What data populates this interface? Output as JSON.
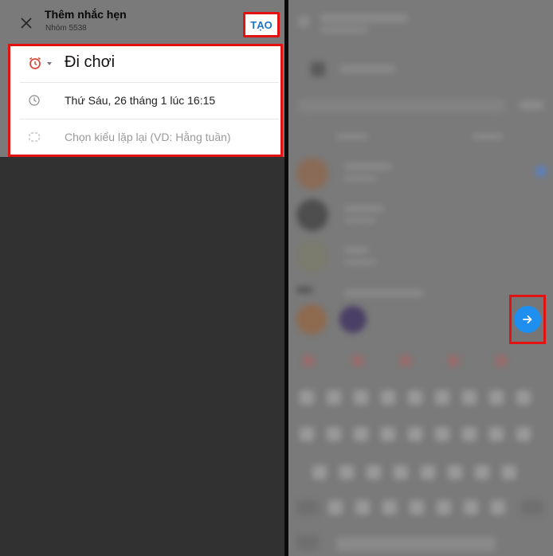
{
  "left": {
    "header": {
      "title": "Thêm nhắc hẹn",
      "subtitle": "Nhóm 5538",
      "create_label": "TẠO"
    },
    "form": {
      "event_name": "Đi chơi",
      "datetime": "Thứ Sáu, 26 tháng 1 lúc 16:15",
      "repeat_placeholder": "Chọn kiểu lặp lại (VD: Hằng tuần)"
    }
  },
  "colors": {
    "highlight": "#e21212",
    "accent_blue": "#1a73c9",
    "fab_blue": "#1e8fef",
    "alarm_red": "#d94b3d"
  },
  "icons": {
    "close": "close-icon",
    "alarm": "alarm-clock-icon",
    "clock": "clock-icon",
    "repeat": "repeat-icon",
    "next": "arrow-right-icon"
  }
}
